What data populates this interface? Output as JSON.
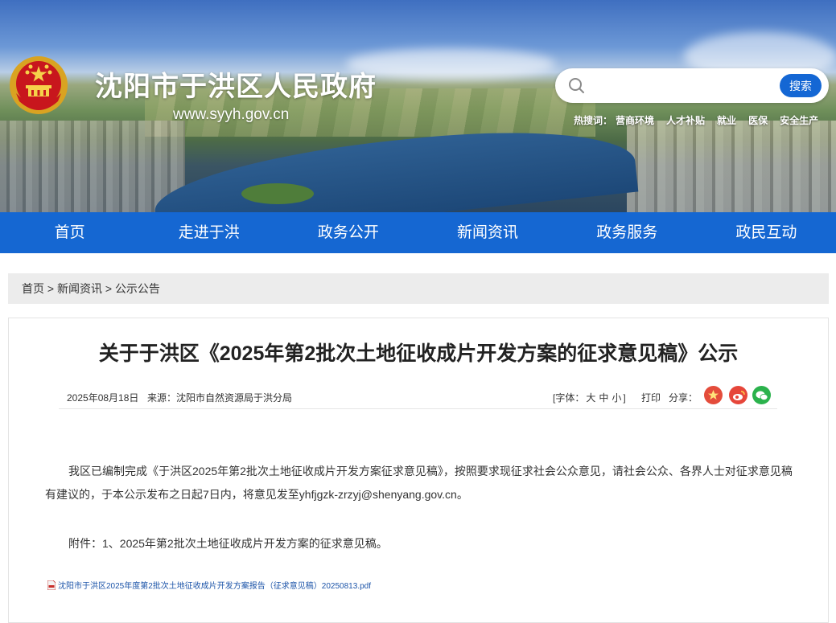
{
  "header": {
    "site_title": "沈阳市于洪区人民政府",
    "site_url": "www.syyh.gov.cn",
    "emblem": "national-emblem",
    "search": {
      "placeholder": "",
      "value": "",
      "button_label": "搜索"
    },
    "hotwords": {
      "label": "热搜词：",
      "items": [
        "营商环境",
        "人才补贴",
        "就业",
        "医保",
        "安全生产"
      ]
    }
  },
  "nav": {
    "items": [
      {
        "label": "首页"
      },
      {
        "label": "走进于洪"
      },
      {
        "label": "政务公开"
      },
      {
        "label": "新闻资讯"
      },
      {
        "label": "政务服务"
      },
      {
        "label": "政民互动"
      }
    ]
  },
  "breadcrumb": {
    "items": [
      "首页",
      "新闻资讯",
      "公示公告"
    ],
    "separator": " > "
  },
  "article": {
    "title": "关于于洪区《2025年第2批次土地征收成片开发方案的征求意见稿》公示",
    "date": "2025年08月18日",
    "source": "来源：沈阳市自然资源局于洪分局",
    "font_label": "[字体：",
    "font_sizes": [
      "大",
      "中",
      "小"
    ],
    "font_close": "]",
    "print_label": "打印",
    "share_label": "分享：",
    "share_icons": [
      "party-emblem-icon",
      "weibo-icon",
      "wechat-icon"
    ],
    "paragraph_1": "我区已编制完成《于洪区2025年第2批次土地征收成片开发方案征求意见稿》，按照要求现征求社会公众意见，请社会公众、各界人士对征求意见稿有建议的，于本公示发布之日起7日内，将意见发至yhfjgzk-zrzyj@shenyang.gov.cn。",
    "paragraph_2": "附件：1、2025年第2批次土地征收成片开发方案的征求意见稿。",
    "attachment": "沈阳市于洪区2025年度第2批次土地征收成片开发方案报告（征求意见稿）20250813.pdf"
  },
  "colors": {
    "brand_blue": "#1567d2",
    "search_button": "#1467d4",
    "breadcrumb_bg": "#ececec",
    "link": "#1d55a9"
  }
}
